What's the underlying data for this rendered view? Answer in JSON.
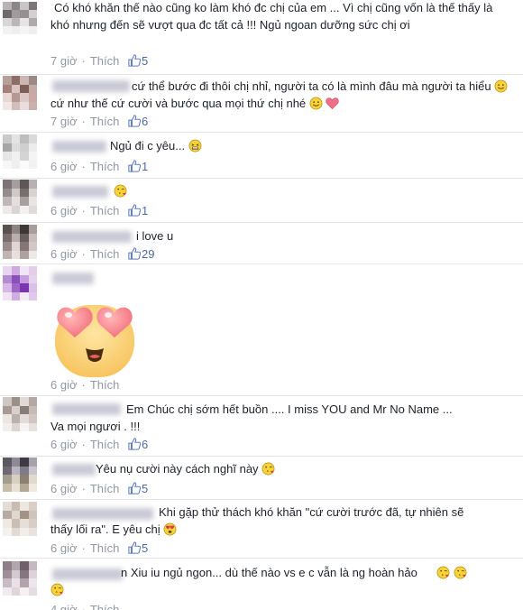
{
  "comments": [
    {
      "text": "Có khó khăn thế nào cũng ko làm khó đc chị của em ... Vì chị cũng vốn là thế thấy là khó nhưng đến sẽ vượt qua đc tất cả !!! Ngủ ngoan dưỡng sức chị ơi",
      "time": "7 giờ",
      "like_label": "Thích",
      "likes": "5"
    },
    {
      "text": "cứ thể bước đi thôi chị nhỉ, người ta có là mình đâu mà người ta hiểu",
      "text2": "cứ như thế cứ cười và bước qua mọi thứ chị nhé",
      "time": "7 giờ",
      "like_label": "Thích",
      "likes": "6"
    },
    {
      "text": "Ngủ đi c yêu...",
      "time": "6 giờ",
      "like_label": "Thích",
      "likes": "1"
    },
    {
      "time": "6 giờ",
      "like_label": "Thích",
      "likes": "1"
    },
    {
      "text": "i love u",
      "time": "6 giờ",
      "like_label": "Thích",
      "likes": "29"
    },
    {
      "time": "6 giờ",
      "like_label": "Thích"
    },
    {
      "text": "Em Chúc chị sớm hết buồn .... I miss YOU and Mr No Name ...",
      "text2": "Va mọi ngươi . !!!",
      "time": "6 giờ",
      "like_label": "Thích",
      "likes": "6"
    },
    {
      "text": "Yêu nụ cười này cách nghĩ này",
      "time": "6 giờ",
      "like_label": "Thích",
      "likes": "5"
    },
    {
      "text": "Khi gặp thử thách khó khăn \"cứ cười trước đã, tự nhiên sẽ",
      "text2": "thấy lối ra\". E yêu chị",
      "time": "6 giờ",
      "like_label": "Thích",
      "likes": "5"
    },
    {
      "text": "n Xiu iu ngủ ngon... dù thế nào vs e c vẫn là ng hoàn hảo",
      "time": "4 giờ",
      "like_label": "Thích"
    }
  ],
  "colors": {
    "meta": "#9197a3",
    "link": "#4e69a2",
    "text": "#1d2129"
  },
  "icons": [
    "thumbs-up-icon",
    "smile-emoji",
    "heart-emoji",
    "grin-emoji",
    "kiss-emoji",
    "heart-eyes-emoji"
  ]
}
